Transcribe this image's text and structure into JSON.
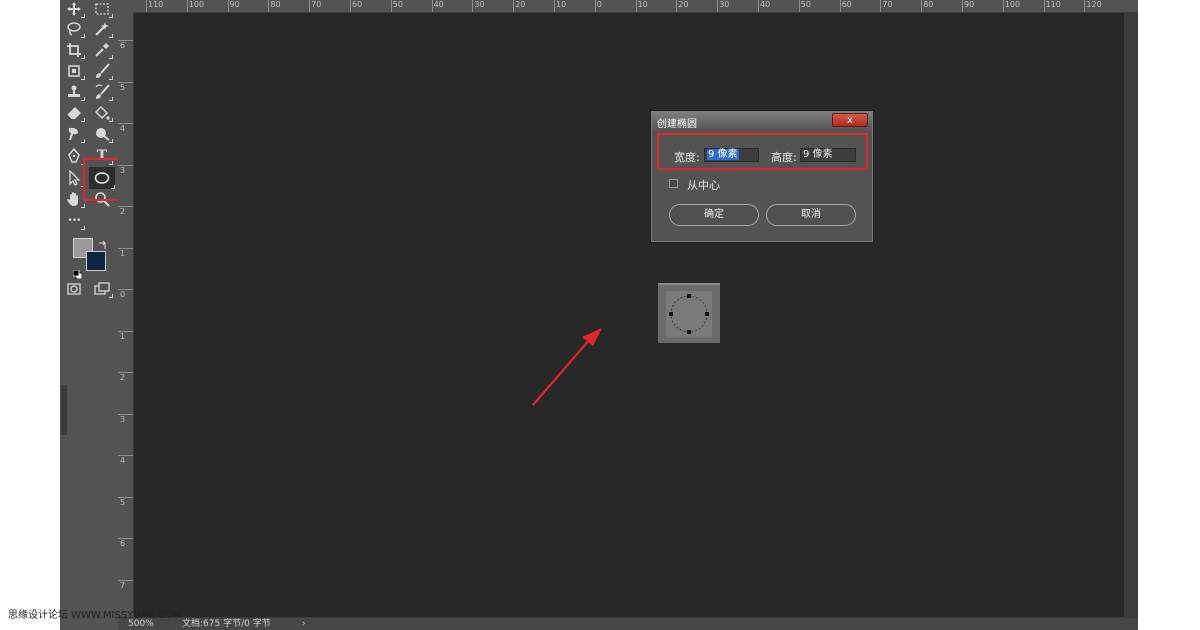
{
  "status_bar": {
    "zoom": "500%",
    "doc_info": "文档:675 字节/0 字节",
    "arrow": "›"
  },
  "dialog": {
    "title": "创建椭圆",
    "close_symbol": "x",
    "width_label": "宽度:",
    "width_value": "9 像素",
    "height_label": "高度:",
    "height_value": "9 像素",
    "from_center_label": "从中心",
    "ok_label": "确定",
    "cancel_label": "取消"
  },
  "ruler": {
    "top_ticks": [
      "110",
      "100",
      "90",
      "80",
      "70",
      "60",
      "50",
      "40",
      "30",
      "20",
      "10",
      "0",
      "10",
      "20",
      "30",
      "40",
      "50",
      "60",
      "70",
      "80",
      "90",
      "100",
      "110",
      "120"
    ],
    "left_ticks": [
      "6",
      "5",
      "4",
      "3",
      "2",
      "1",
      "0",
      "1",
      "2",
      "3",
      "4",
      "5",
      "6",
      "7"
    ]
  },
  "tools": {
    "text_glyph": "T",
    "more_glyph": "•••"
  },
  "colors": {
    "foreground": "#9a9a9a",
    "background": "#0f2342",
    "highlight": "#e2272a",
    "selection": "#2f6bd0"
  },
  "watermark": "思缘设计论坛 WWW.MISSYUAN.COM"
}
